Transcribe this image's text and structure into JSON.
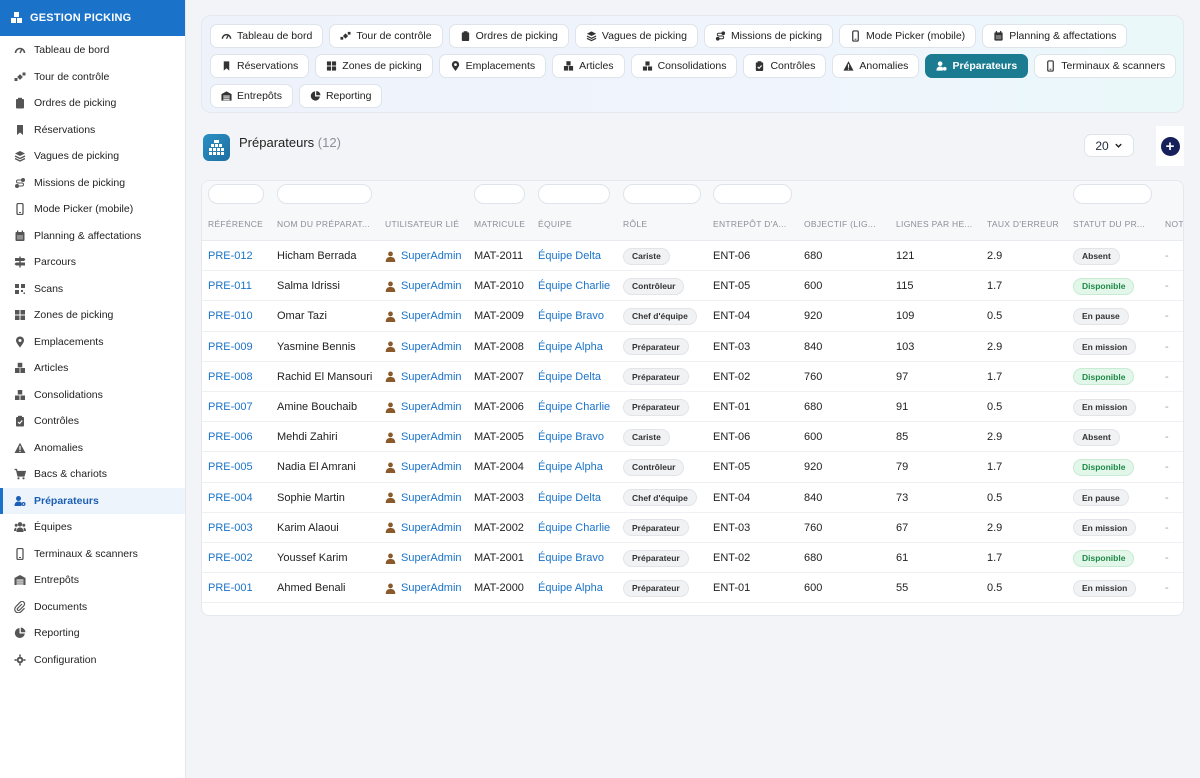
{
  "app": {
    "title": "GESTION PICKING"
  },
  "sidebar": {
    "items": [
      {
        "label": "Tableau de bord",
        "icon": "gauge-icon"
      },
      {
        "label": "Tour de contrôle",
        "icon": "satellite-icon"
      },
      {
        "label": "Ordres de picking",
        "icon": "clipboard-icon"
      },
      {
        "label": "Réservations",
        "icon": "bookmark-icon"
      },
      {
        "label": "Vagues de picking",
        "icon": "layers-icon"
      },
      {
        "label": "Missions de picking",
        "icon": "route-icon"
      },
      {
        "label": "Mode Picker (mobile)",
        "icon": "mobile-icon"
      },
      {
        "label": "Planning & affectations",
        "icon": "calendar-icon"
      },
      {
        "label": "Parcours",
        "icon": "signs-icon"
      },
      {
        "label": "Scans",
        "icon": "qrcode-icon"
      },
      {
        "label": "Zones de picking",
        "icon": "grid-icon"
      },
      {
        "label": "Emplacements",
        "icon": "map-pin-icon"
      },
      {
        "label": "Articles",
        "icon": "boxes-icon"
      },
      {
        "label": "Consolidations",
        "icon": "cubes-icon"
      },
      {
        "label": "Contrôles",
        "icon": "clipboard-check-icon"
      },
      {
        "label": "Anomalies",
        "icon": "warning-icon"
      },
      {
        "label": "Bacs & chariots",
        "icon": "cart-icon"
      },
      {
        "label": "Préparateurs",
        "icon": "user-gear-icon",
        "active": true
      },
      {
        "label": "Équipes",
        "icon": "users-icon"
      },
      {
        "label": "Terminaux & scanners",
        "icon": "mobile-icon"
      },
      {
        "label": "Entrepôts",
        "icon": "warehouse-icon"
      },
      {
        "label": "Documents",
        "icon": "paperclip-icon"
      },
      {
        "label": "Reporting",
        "icon": "pie-chart-icon"
      },
      {
        "label": "Configuration",
        "icon": "gear-icon"
      }
    ]
  },
  "tabs": {
    "row1": [
      {
        "label": "Tableau de bord",
        "icon": "gauge-icon"
      },
      {
        "label": "Tour de contrôle",
        "icon": "satellite-icon"
      },
      {
        "label": "Ordres de picking",
        "icon": "clipboard-icon"
      },
      {
        "label": "Vagues de picking",
        "icon": "layers-icon"
      },
      {
        "label": "Missions de picking",
        "icon": "route-icon"
      },
      {
        "label": "Mode Picker (mobile)",
        "icon": "mobile-icon"
      },
      {
        "label": "Planning & affectations",
        "icon": "calendar-icon"
      }
    ],
    "row2": [
      {
        "label": "Réservations",
        "icon": "bookmark-icon"
      },
      {
        "label": "Zones de picking",
        "icon": "grid-icon"
      },
      {
        "label": "Emplacements",
        "icon": "map-pin-icon"
      },
      {
        "label": "Articles",
        "icon": "boxes-icon"
      },
      {
        "label": "Consolidations",
        "icon": "cubes-icon"
      },
      {
        "label": "Contrôles",
        "icon": "clipboard-check-icon"
      },
      {
        "label": "Anomalies",
        "icon": "warning-icon"
      },
      {
        "label": "Préparateurs",
        "icon": "user-gear-icon",
        "active": true
      },
      {
        "label": "Terminaux & scanners",
        "icon": "mobile-icon"
      }
    ],
    "row3": [
      {
        "label": "Entrepôts",
        "icon": "warehouse-icon"
      },
      {
        "label": "Reporting",
        "icon": "pie-chart-icon"
      }
    ]
  },
  "page": {
    "title": "Préparateurs",
    "count": "(12)",
    "page_size": "20"
  },
  "table": {
    "columns": [
      "RÉFÉRENCE",
      "NOM DU PRÉPARAT...",
      "UTILISATEUR LIÉ",
      "MATRICULE",
      "ÉQUIPE",
      "RÔLE",
      "ENTREPÔT D'A...",
      "OBJECTIF (LIG...",
      "LIGNES PAR HE...",
      "TAUX D'ERREUR",
      "STATUT DU PR...",
      "NOT"
    ],
    "rows": [
      {
        "ref": "PRE-012",
        "name": "Hicham Berrada",
        "user": "SuperAdmin",
        "matricule": "MAT-2011",
        "equipe": "Équipe Delta",
        "role": "Cariste",
        "entrepot": "ENT-06",
        "objectif": "680",
        "lignes": "121",
        "taux": "2.9",
        "statut": "Absent",
        "statut_kind": "absent",
        "note": "-"
      },
      {
        "ref": "PRE-011",
        "name": "Salma Idrissi",
        "user": "SuperAdmin",
        "matricule": "MAT-2010",
        "equipe": "Équipe Charlie",
        "role": "Contrôleur",
        "entrepot": "ENT-05",
        "objectif": "600",
        "lignes": "115",
        "taux": "1.7",
        "statut": "Disponible",
        "statut_kind": "dispo",
        "note": "-"
      },
      {
        "ref": "PRE-010",
        "name": "Omar Tazi",
        "user": "SuperAdmin",
        "matricule": "MAT-2009",
        "equipe": "Équipe Bravo",
        "role": "Chef d'équipe",
        "entrepot": "ENT-04",
        "objectif": "920",
        "lignes": "109",
        "taux": "0.5",
        "statut": "En pause",
        "statut_kind": "pause",
        "note": "-"
      },
      {
        "ref": "PRE-009",
        "name": "Yasmine Bennis",
        "user": "SuperAdmin",
        "matricule": "MAT-2008",
        "equipe": "Équipe Alpha",
        "role": "Préparateur",
        "entrepot": "ENT-03",
        "objectif": "840",
        "lignes": "103",
        "taux": "2.9",
        "statut": "En mission",
        "statut_kind": "mission",
        "note": "-"
      },
      {
        "ref": "PRE-008",
        "name": "Rachid El Mansouri",
        "user": "SuperAdmin",
        "matricule": "MAT-2007",
        "equipe": "Équipe Delta",
        "role": "Préparateur",
        "entrepot": "ENT-02",
        "objectif": "760",
        "lignes": "97",
        "taux": "1.7",
        "statut": "Disponible",
        "statut_kind": "dispo",
        "note": "-"
      },
      {
        "ref": "PRE-007",
        "name": "Amine Bouchaib",
        "user": "SuperAdmin",
        "matricule": "MAT-2006",
        "equipe": "Équipe Charlie",
        "role": "Préparateur",
        "entrepot": "ENT-01",
        "objectif": "680",
        "lignes": "91",
        "taux": "0.5",
        "statut": "En mission",
        "statut_kind": "mission",
        "note": "-"
      },
      {
        "ref": "PRE-006",
        "name": "Mehdi Zahiri",
        "user": "SuperAdmin",
        "matricule": "MAT-2005",
        "equipe": "Équipe Bravo",
        "role": "Cariste",
        "entrepot": "ENT-06",
        "objectif": "600",
        "lignes": "85",
        "taux": "2.9",
        "statut": "Absent",
        "statut_kind": "absent",
        "note": "-"
      },
      {
        "ref": "PRE-005",
        "name": "Nadia El Amrani",
        "user": "SuperAdmin",
        "matricule": "MAT-2004",
        "equipe": "Équipe Alpha",
        "role": "Contrôleur",
        "entrepot": "ENT-05",
        "objectif": "920",
        "lignes": "79",
        "taux": "1.7",
        "statut": "Disponible",
        "statut_kind": "dispo",
        "note": "-"
      },
      {
        "ref": "PRE-004",
        "name": "Sophie Martin",
        "user": "SuperAdmin",
        "matricule": "MAT-2003",
        "equipe": "Équipe Delta",
        "role": "Chef d'équipe",
        "entrepot": "ENT-04",
        "objectif": "840",
        "lignes": "73",
        "taux": "0.5",
        "statut": "En pause",
        "statut_kind": "pause",
        "note": "-"
      },
      {
        "ref": "PRE-003",
        "name": "Karim Alaoui",
        "user": "SuperAdmin",
        "matricule": "MAT-2002",
        "equipe": "Équipe Charlie",
        "role": "Préparateur",
        "entrepot": "ENT-03",
        "objectif": "760",
        "lignes": "67",
        "taux": "2.9",
        "statut": "En mission",
        "statut_kind": "mission",
        "note": "-"
      },
      {
        "ref": "PRE-002",
        "name": "Youssef Karim",
        "user": "SuperAdmin",
        "matricule": "MAT-2001",
        "equipe": "Équipe Bravo",
        "role": "Préparateur",
        "entrepot": "ENT-02",
        "objectif": "680",
        "lignes": "61",
        "taux": "1.7",
        "statut": "Disponible",
        "statut_kind": "dispo",
        "note": "-"
      },
      {
        "ref": "PRE-001",
        "name": "Ahmed Benali",
        "user": "SuperAdmin",
        "matricule": "MAT-2000",
        "equipe": "Équipe Alpha",
        "role": "Préparateur",
        "entrepot": "ENT-01",
        "objectif": "600",
        "lignes": "55",
        "taux": "0.5",
        "statut": "En mission",
        "statut_kind": "mission",
        "note": "-"
      }
    ]
  },
  "colors": {
    "brand": "#1a73c9",
    "active_tab": "#1b7b91",
    "link": "#1a73c9",
    "add_button": "#16205a"
  }
}
